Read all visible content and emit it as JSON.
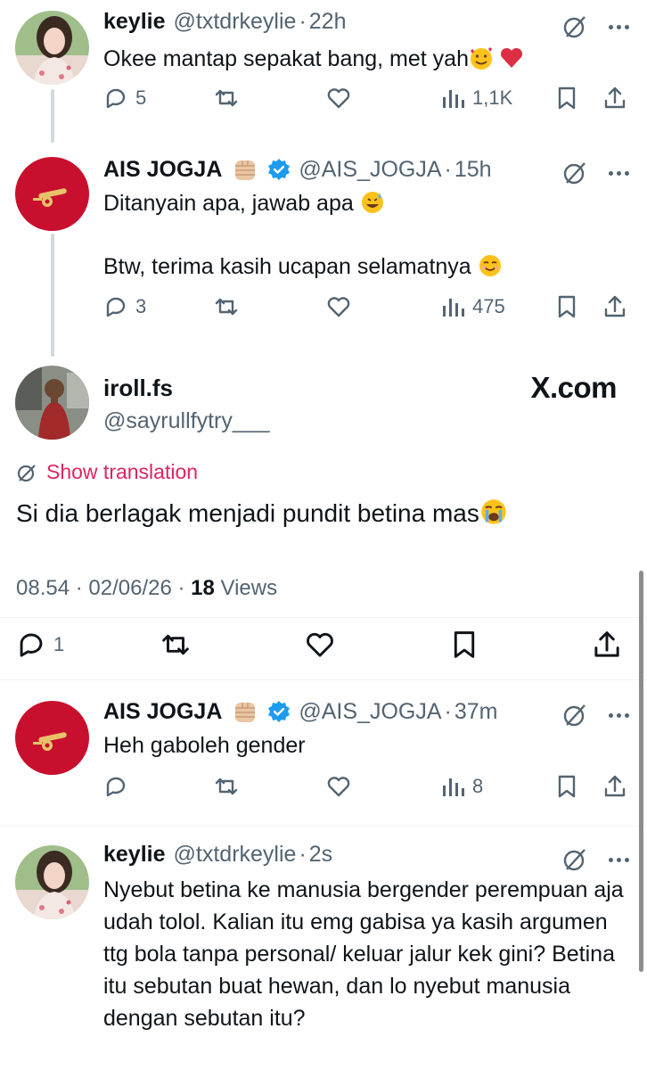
{
  "tweets": [
    {
      "name": "keylie",
      "handle": "@txtdrkeylie",
      "time": "22h",
      "text": "Okee mantap sepakat bang, met yah",
      "replies": "5",
      "views": "1,1K"
    },
    {
      "name": "AIS JOGJA",
      "handle": "@AIS_JOGJA",
      "time": "15h",
      "text_line1": "Ditanyain apa, jawab apa",
      "text_line2": "Btw, terima kasih ucapan selamatnya",
      "replies": "3",
      "views": "475"
    }
  ],
  "focused": {
    "name": "iroll.fs",
    "handle": "@sayrullfytry___",
    "watermark": "X.com",
    "show_translation": "Show translation",
    "text": "Si dia berlagak menjadi pundit betina mas",
    "timestamp": "08.54 · 02/06/26 ·",
    "views_count": "18",
    "views_label": "Views",
    "replies": "1"
  },
  "replies": [
    {
      "name": "AIS JOGJA",
      "handle": "@AIS_JOGJA",
      "time": "37m",
      "text": "Heh gaboleh gender",
      "views": "8"
    },
    {
      "name": "keylie",
      "handle": "@txtdrkeylie",
      "time": "2s",
      "text": "Nyebut betina ke manusia bergender perempuan aja udah tolol. Kalian itu emg gabisa ya kasih argumen ttg bola tanpa personal/ keluar jalur kek gini? Betina itu sebutan buat hewan, dan lo nyebut manusia dengan sebutan itu?"
    }
  ],
  "colors": {
    "text": "#0f1419",
    "muted": "#536471",
    "accent_pink": "#e0245e",
    "verified": "#1d9bf0",
    "arsenal_red": "#c8102e",
    "divider": "#eff3f4"
  },
  "icons": [
    "reply-icon",
    "retweet-icon",
    "like-icon",
    "views-icon",
    "bookmark-icon",
    "share-icon",
    "grok-icon",
    "more-icon",
    "verified-icon",
    "fist-emoji",
    "translate-icon"
  ]
}
